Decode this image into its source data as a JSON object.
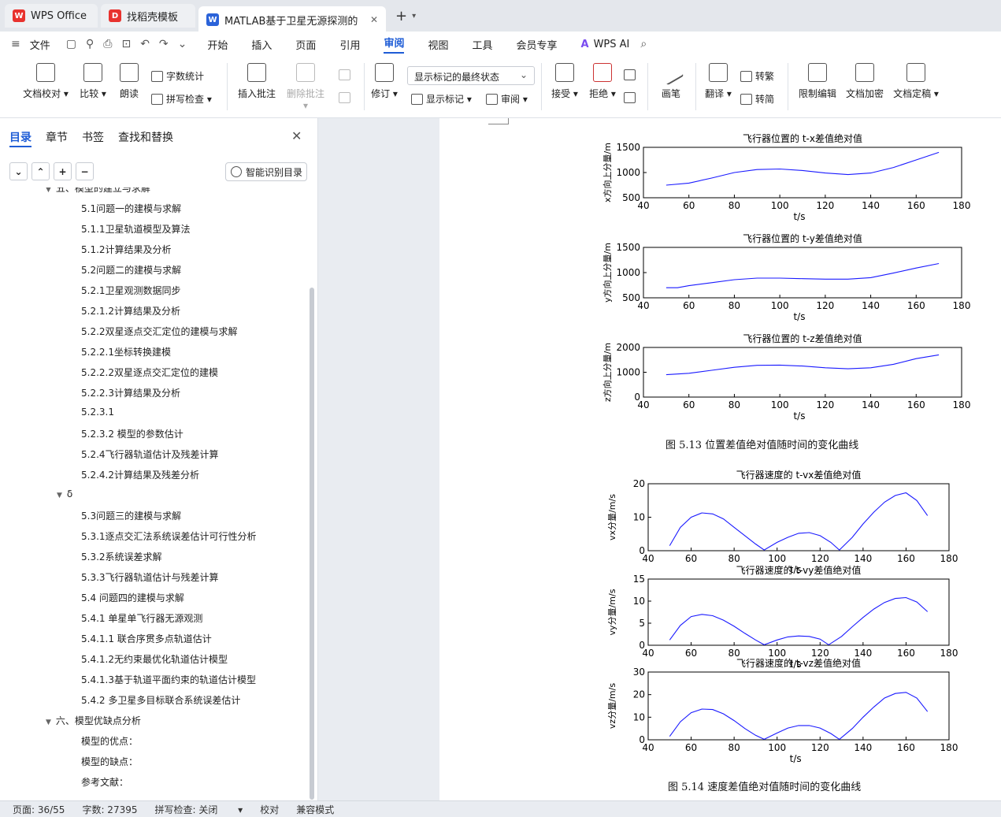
{
  "tabs": [
    {
      "label": "WPS Office",
      "logo": "W"
    },
    {
      "label": "找稻壳模板",
      "logo": "D"
    },
    {
      "label": "MATLAB基于卫星无源探测的空",
      "logo": "W"
    }
  ],
  "menu": {
    "file": "文件",
    "items": [
      "开始",
      "插入",
      "页面",
      "引用",
      "审阅",
      "视图",
      "工具",
      "会员专享"
    ],
    "active": "审阅",
    "ai": "WPS AI"
  },
  "ribbon": {
    "doc_check": "文档校对",
    "compare": "比较",
    "read_aloud": "朗读",
    "word_count": "字数统计",
    "spell_check": "拼写检查",
    "insert_comment": "插入批注",
    "delete_comment": "删除批注",
    "revise": "修订",
    "markup_dropdown": "显示标记的最终状态",
    "show_markup": "显示标记",
    "review": "审阅",
    "accept": "接受",
    "reject": "拒绝",
    "pen": "画笔",
    "translate": "翻译",
    "to_traditional": "转繁",
    "to_simplified": "转简",
    "restrict_edit": "限制编辑",
    "encrypt": "文档加密",
    "finalize": "文档定稿"
  },
  "nav": {
    "tabs": [
      "目录",
      "章节",
      "书签",
      "查找和替换"
    ],
    "active": "目录",
    "smart_btn": "智能识别目录",
    "toc": [
      {
        "text": "五、模型的建立与求解",
        "level": 0,
        "expand": true
      },
      {
        "text": "5.1问题一的建模与求解",
        "level": 2
      },
      {
        "text": "5.1.1卫星轨道模型及算法",
        "level": 2
      },
      {
        "text": "5.1.2计算结果及分析",
        "level": 2
      },
      {
        "text": "5.2问题二的建模与求解",
        "level": 2
      },
      {
        "text": "5.2.1卫星观测数据同步",
        "level": 2
      },
      {
        "text": "5.2.1.2计算结果及分析",
        "level": 2
      },
      {
        "text": "5.2.2双星逐点交汇定位的建模与求解",
        "level": 2
      },
      {
        "text": "5.2.2.1坐标转换建模",
        "level": 2
      },
      {
        "text": "5.2.2.2双星逐点交汇定位的建模",
        "level": 2
      },
      {
        "text": "5.2.2.3计算结果及分析",
        "level": 2
      },
      {
        "text": "5.2.3.1",
        "level": 2
      },
      {
        "text": "5.2.3.2 模型的参数估计",
        "level": 2
      },
      {
        "text": "5.2.4飞行器轨道估计及残差计算",
        "level": 2
      },
      {
        "text": "5.2.4.2计算结果及残差分析",
        "level": 2
      },
      {
        "text": "δ",
        "level": 1,
        "expand": true
      },
      {
        "text": "5.3问题三的建模与求解",
        "level": 2
      },
      {
        "text": "5.3.1逐点交汇法系统误差估计可行性分析",
        "level": 2
      },
      {
        "text": "5.3.2系统误差求解",
        "level": 2
      },
      {
        "text": "5.3.3飞行器轨道估计与残差计算",
        "level": 2
      },
      {
        "text": "5.4 问题四的建模与求解",
        "level": 2
      },
      {
        "text": "5.4.1 单星单飞行器无源观测",
        "level": 2
      },
      {
        "text": "5.4.1.1 联合序贯多点轨道估计",
        "level": 2
      },
      {
        "text": "5.4.1.2无约束最优化轨道估计模型",
        "level": 2
      },
      {
        "text": "5.4.1.3基于轨道平面约束的轨道估计模型",
        "level": 2
      },
      {
        "text": "5.4.2 多卫星多目标联合系统误差估计",
        "level": 2
      },
      {
        "text": "六、模型优缺点分析",
        "level": 0,
        "expand": true
      },
      {
        "text": "模型的优点：",
        "level": 2
      },
      {
        "text": "模型的缺点：",
        "level": 2
      },
      {
        "text": "参考文献：",
        "level": 2
      }
    ]
  },
  "doc": {
    "caption1": "图 5.13      位置差值绝对值随时间的变化曲线",
    "caption2": "图 5.14    速度差值绝对值随时间的变化曲线"
  },
  "chart_data": [
    {
      "type": "line",
      "title": "飞行器位置的  t-x差值绝对值",
      "xlabel": "t/s",
      "ylabel": "x方向上分量/m",
      "xlim": [
        40,
        180
      ],
      "ylim": [
        500,
        1500
      ],
      "yticks": [
        500,
        1000,
        1500
      ],
      "xticks": [
        40,
        60,
        80,
        100,
        120,
        140,
        160,
        180
      ],
      "x": [
        50,
        60,
        70,
        80,
        90,
        100,
        110,
        120,
        130,
        140,
        150,
        160,
        170
      ],
      "y": [
        750,
        790,
        890,
        1000,
        1060,
        1070,
        1040,
        990,
        960,
        990,
        1100,
        1250,
        1400
      ]
    },
    {
      "type": "line",
      "title": "飞行器位置的  t-y差值绝对值",
      "xlabel": "t/s",
      "ylabel": "y方向上分量/m",
      "xlim": [
        40,
        180
      ],
      "ylim": [
        500,
        1500
      ],
      "yticks": [
        500,
        1000,
        1500
      ],
      "xticks": [
        40,
        60,
        80,
        100,
        120,
        140,
        160,
        180
      ],
      "x": [
        50,
        55,
        60,
        70,
        80,
        90,
        100,
        110,
        120,
        130,
        140,
        150,
        160,
        170
      ],
      "y": [
        700,
        700,
        740,
        800,
        860,
        890,
        890,
        880,
        870,
        870,
        900,
        990,
        1090,
        1180
      ]
    },
    {
      "type": "line",
      "title": "飞行器位置的  t-z差值绝对值",
      "xlabel": "t/s",
      "ylabel": "z方向上分量/m",
      "xlim": [
        40,
        180
      ],
      "ylim": [
        0,
        2000
      ],
      "yticks": [
        0,
        1000,
        2000
      ],
      "xticks": [
        40,
        60,
        80,
        100,
        120,
        140,
        160,
        180
      ],
      "x": [
        50,
        60,
        70,
        80,
        90,
        100,
        110,
        120,
        130,
        140,
        150,
        160,
        170
      ],
      "y": [
        900,
        960,
        1080,
        1200,
        1280,
        1290,
        1250,
        1180,
        1140,
        1180,
        1320,
        1550,
        1700
      ]
    },
    {
      "type": "line",
      "title": "飞行器速度的  t-vx差值绝对值",
      "xlabel": "t/s",
      "ylabel": "vx分量/m/s",
      "xlim": [
        40,
        180
      ],
      "ylim": [
        0,
        20
      ],
      "yticks": [
        0,
        10,
        20
      ],
      "xticks": [
        40,
        60,
        80,
        100,
        120,
        140,
        160,
        180
      ],
      "x": [
        50,
        55,
        60,
        65,
        70,
        75,
        80,
        85,
        90,
        94,
        100,
        105,
        110,
        115,
        120,
        125,
        129,
        135,
        140,
        145,
        150,
        155,
        160,
        165,
        170
      ],
      "y": [
        1.5,
        7,
        10,
        11.3,
        11,
        9.5,
        7,
        4.5,
        2,
        0.2,
        2.5,
        4,
        5.2,
        5.4,
        4.5,
        2.5,
        0.2,
        4,
        8,
        11.5,
        14.5,
        16.5,
        17.3,
        15,
        10.5
      ]
    },
    {
      "type": "line",
      "title": "飞行器速度的  t-vy差值绝对值",
      "xlabel": "t/s",
      "ylabel": "vy分量/m/s",
      "xlim": [
        40,
        180
      ],
      "ylim": [
        0,
        15
      ],
      "yticks": [
        0,
        5,
        10,
        15
      ],
      "xticks": [
        40,
        60,
        80,
        100,
        120,
        140,
        160,
        180
      ],
      "x": [
        50,
        55,
        60,
        65,
        70,
        75,
        80,
        85,
        90,
        94,
        100,
        105,
        110,
        115,
        120,
        124,
        130,
        135,
        140,
        145,
        150,
        155,
        160,
        165,
        170
      ],
      "y": [
        1.2,
        4.5,
        6.5,
        7,
        6.7,
        5.7,
        4.3,
        2.7,
        1.2,
        0.1,
        1.2,
        1.9,
        2.1,
        2,
        1.4,
        0.1,
        2,
        4.2,
        6.3,
        8.2,
        9.7,
        10.6,
        10.8,
        9.8,
        7.6
      ]
    },
    {
      "type": "line",
      "title": "飞行器速度的  t-vz差值绝对值",
      "xlabel": "t/s",
      "ylabel": "vz分量/m/s",
      "xlim": [
        40,
        180
      ],
      "ylim": [
        0,
        30
      ],
      "yticks": [
        0,
        10,
        20,
        30
      ],
      "xticks": [
        40,
        60,
        80,
        100,
        120,
        140,
        160,
        180
      ],
      "x": [
        50,
        55,
        60,
        65,
        70,
        75,
        80,
        85,
        90,
        94,
        100,
        105,
        110,
        115,
        120,
        125,
        129,
        135,
        140,
        145,
        150,
        155,
        160,
        165,
        170
      ],
      "y": [
        1.5,
        8,
        12,
        13.6,
        13.4,
        11.5,
        8.5,
        5,
        2,
        0.2,
        3,
        5.2,
        6.3,
        6.3,
        5.2,
        2.8,
        0.2,
        5,
        10,
        14.5,
        18.5,
        20.5,
        21,
        18.5,
        12.5
      ]
    }
  ],
  "status": {
    "page": "页面: 36/55",
    "words": "字数: 27395",
    "spell": "拼写检查: 关闭",
    "proof": "校对",
    "compat": "兼容模式"
  }
}
